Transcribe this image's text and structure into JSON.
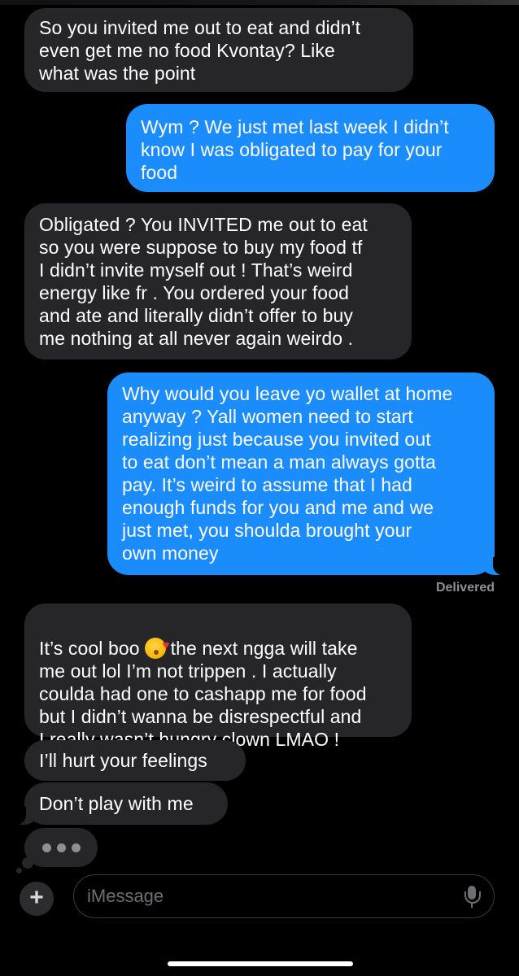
{
  "messages": [
    {
      "from": "them",
      "text": "So you invited me out to eat and didn’t\neven get me no food Kvontay? Like\nwhat was the point"
    },
    {
      "from": "me",
      "text": "Wym ? We just met last week I didn’t\nknow I was obligated to pay for your\nfood"
    },
    {
      "from": "them",
      "text": "Obligated ? You INVITED me out to eat\nso you were suppose to buy my food tf\nI didn’t invite myself out ! That’s weird\nenergy like fr . You ordered your food\nand ate and literally didn’t offer to buy\nme nothing at all never again weirdo ."
    },
    {
      "from": "me",
      "text": "Why would you leave yo wallet at home\nanyway ? Yall women need to start\nrealizing just because you invited out\nto eat don’t mean a man always gotta\npay. It’s weird to assume that I had\nenough funds for you and me and we\njust met, you shoulda brought your\nown money"
    },
    {
      "from": "them",
      "text_before_emoji": "It’s cool boo",
      "emoji": "face-blowing-a-kiss-emoji",
      "text_after_emoji": "the next ngga will take\nme out lol I’m not trippen . I actually\ncoulda had one to cashapp me for food\nbut I didn’t wanna be disrespectful and\nI really wasn’t hungry clown LMAO !"
    },
    {
      "from": "them",
      "text": "I’ll hurt your feelings"
    },
    {
      "from": "them",
      "text": "Don’t play with me"
    }
  ],
  "status": {
    "delivered": "Delivered"
  },
  "typing_indicator": {
    "icon": "typing-dots-icon"
  },
  "composer": {
    "placeholder": "iMessage",
    "plus_icon": "plus-icon",
    "plus_glyph": "+",
    "mic_icon": "microphone-icon"
  },
  "colors": {
    "background": "#000000",
    "incoming_bubble": "#262628",
    "outgoing_bubble": "#1b8cfb",
    "text": "#ffffff",
    "muted": "#8e8e93"
  }
}
